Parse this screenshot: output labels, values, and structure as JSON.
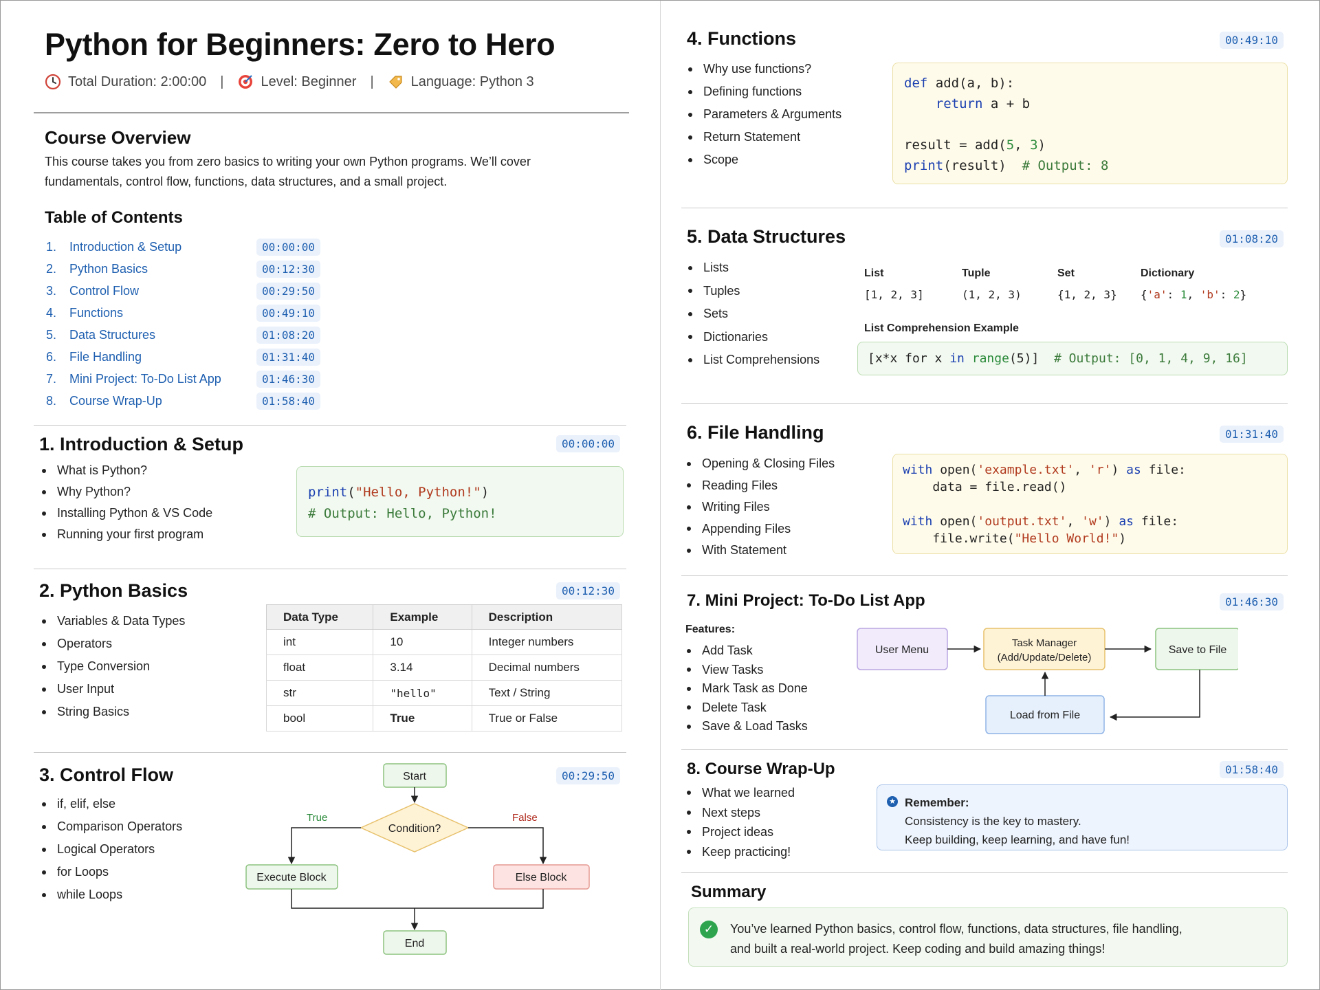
{
  "header": {
    "title": "Python for Beginners: Zero to Hero",
    "duration": "Total Duration: 2:00:00",
    "level": "Level: Beginner",
    "language": "Language: Python 3",
    "sep": "|"
  },
  "overview": {
    "heading": "Course Overview",
    "line1": "This course takes you from zero basics to writing your own Python programs. We’ll cover",
    "line2": "fundamentals, control flow, functions, data structures, and a small project."
  },
  "toc": {
    "heading": "Table of Contents",
    "items": [
      {
        "num": "1.",
        "label": "Introduction & Setup",
        "time": "00:00:00"
      },
      {
        "num": "2.",
        "label": "Python Basics",
        "time": "00:12:30"
      },
      {
        "num": "3.",
        "label": "Control Flow",
        "time": "00:29:50"
      },
      {
        "num": "4.",
        "label": "Functions",
        "time": "00:49:10"
      },
      {
        "num": "5.",
        "label": "Data Structures",
        "time": "01:08:20"
      },
      {
        "num": "6.",
        "label": "File Handling",
        "time": "01:31:40"
      },
      {
        "num": "7.",
        "label": "Mini Project: To-Do List App",
        "time": "01:46:30"
      },
      {
        "num": "8.",
        "label": "Course Wrap-Up",
        "time": "01:58:40"
      }
    ]
  },
  "s1": {
    "heading": "1. Introduction & Setup",
    "time": "00:00:00",
    "bullets": [
      "What is Python?",
      "Why Python?",
      "Installing Python & VS Code",
      "Running your first program"
    ],
    "code": {
      "l1_fn": "print",
      "l1_open": "(",
      "l1_str": "\"Hello, Python!\"",
      "l1_close": ")",
      "l2": "# Output: Hello, Python!"
    }
  },
  "s2": {
    "heading": "2. Python Basics",
    "time": "00:12:30",
    "bullets": [
      "Variables & Data Types",
      "Operators",
      "Type Conversion",
      "User Input",
      "String Basics"
    ],
    "table": {
      "headers": [
        "Data Type",
        "Example",
        "Description"
      ],
      "rows": [
        [
          "int",
          "10",
          "Integer numbers"
        ],
        [
          "float",
          "3.14",
          "Decimal numbers"
        ],
        [
          "str",
          "\"hello\"",
          "Text / String"
        ],
        [
          "bool",
          "True",
          "True or False"
        ]
      ]
    }
  },
  "s3": {
    "heading": "3. Control Flow",
    "time": "00:29:50",
    "bullets": [
      "if, elif, else",
      "Comparison Operators",
      "Logical Operators",
      "for Loops",
      "while Loops"
    ],
    "flow": {
      "start": "Start",
      "cond": "Condition?",
      "true": "True",
      "false": "False",
      "exec": "Execute Block",
      "else": "Else Block",
      "end": "End"
    }
  },
  "s4": {
    "heading": "4. Functions",
    "time": "00:49:10",
    "bullets": [
      "Why use functions?",
      "Defining functions",
      "Parameters & Arguments",
      "Return Statement",
      "Scope"
    ],
    "code": {
      "l1_kw": "def",
      "l1_rest": " add(a, b):",
      "l2_kw": "return",
      "l2_rest": " a + b",
      "l3_pre": "result = add(",
      "l3_n1": "5",
      "l3_mid": ", ",
      "l3_n2": "3",
      "l3_post": ")",
      "l4_fn": "print",
      "l4_rest": "(result)  ",
      "l4_com": "# Output: 8"
    }
  },
  "s5": {
    "heading": "5. Data Structures",
    "time": "01:08:20",
    "bullets": [
      "Lists",
      "Tuples",
      "Sets",
      "Dictionaries",
      "List Comprehensions"
    ],
    "types": [
      {
        "name": "List",
        "example": "[1, 2, 3]"
      },
      {
        "name": "Tuple",
        "example": "(1, 2, 3)"
      },
      {
        "name": "Set",
        "example": "{1, 2, 3}"
      },
      {
        "name": "Dictionary",
        "example": "{'a': 1, 'b': 2}"
      }
    ],
    "comp_heading": "List Comprehension Example",
    "comp": {
      "pre": "[x*x for x ",
      "kw": "in",
      "fn": " range",
      "arg": "(5)]  ",
      "com": "# Output: [0, 1, 4, 9, 16]"
    }
  },
  "s6": {
    "heading": "6. File Handling",
    "time": "01:31:40",
    "bullets": [
      "Opening & Closing Files",
      "Reading Files",
      "Writing Files",
      "Appending Files",
      "With Statement"
    ],
    "code": {
      "with": "with",
      "open": " open(",
      "f1": "'example.txt'",
      "comma": ", ",
      "m1": "'r'",
      "close": ") ",
      "as": "as",
      "file": " file:",
      "l2": "    data = file.read()",
      "f2": "'output.txt'",
      "m2": "'w'",
      "l5_pre": "    file.write(",
      "l5_str": "\"Hello World!\"",
      "l5_post": ")"
    }
  },
  "s7": {
    "heading": "7. Mini Project: To-Do List App",
    "time": "01:46:30",
    "features_heading": "Features:",
    "bullets": [
      "Add Task",
      "View Tasks",
      "Mark Task as Done",
      "Delete Task",
      "Save & Load Tasks"
    ],
    "diagram": {
      "menu": "User Menu",
      "tm1": "Task Manager",
      "tm2": "(Add/Update/Delete)",
      "save": "Save to File",
      "load": "Load from File"
    }
  },
  "s8": {
    "heading": "8. Course Wrap-Up",
    "time": "01:58:40",
    "bullets": [
      "What we learned",
      "Next steps",
      "Project ideas",
      "Keep practicing!"
    ],
    "remember_title": "Remember:",
    "remember_l1": "Consistency is the key to mastery.",
    "remember_l2": "Keep building, keep learning, and have fun!"
  },
  "summary": {
    "heading": "Summary",
    "l1": "You’ve learned Python basics, control flow, functions, data structures, file handling,",
    "l2": "and built a real-world project. Keep coding and build amazing things!"
  },
  "colors": {
    "link": "#1e5fb0",
    "code_green": "#f2f9f0",
    "code_yellow": "#fffbea",
    "check": "#2ea44f"
  }
}
